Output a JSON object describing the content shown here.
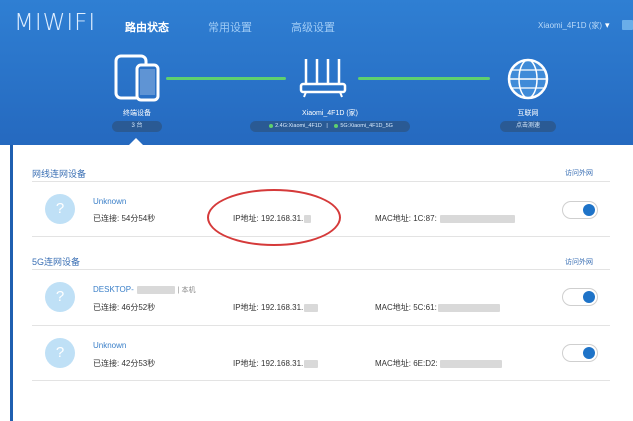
{
  "app": {
    "logo": "MIWIFI"
  },
  "nav": {
    "items": [
      {
        "label": "路由状态",
        "active": true
      },
      {
        "label": "常用设置",
        "active": false
      },
      {
        "label": "高级设置",
        "active": false
      }
    ],
    "user_menu": "Xiaomi_4F1D (家)",
    "chevron": "▾"
  },
  "topology": {
    "devices": {
      "label": "终端设备",
      "count": "3 台"
    },
    "router": {
      "name": "Xiaomi_4F1D (家)",
      "ssid_24": "2.4G:Xiaomi_4F1D",
      "ssid_5": "5G:Xiaomi_4F1D_5G",
      "separator": "|"
    },
    "internet": {
      "label": "互联网",
      "button": "点击测速"
    }
  },
  "sections": [
    {
      "title": "网线连网设备",
      "link": "访问外网",
      "devices": [
        {
          "name": "Unknown",
          "tag": "",
          "connected": "已连接: 54分54秒",
          "ip": "IP地址: 192.168.31.",
          "mac": "MAC地址: 1C:87:",
          "access_enabled": true
        }
      ]
    },
    {
      "title": "5G连网设备",
      "link": "访问外网",
      "devices": [
        {
          "name": "DESKTOP-",
          "tag": "| 本机",
          "connected": "已连接: 46分52秒",
          "ip": "IP地址: 192.168.31.",
          "mac": "MAC地址: 5C:61:",
          "access_enabled": true
        },
        {
          "name": "Unknown",
          "tag": "",
          "connected": "已连接: 42分53秒",
          "ip": "IP地址: 192.168.31.",
          "mac": "MAC地址: 6E:D2:",
          "access_enabled": true
        }
      ]
    }
  ],
  "avatar_glyph": "?",
  "colors": {
    "header_blue": "#2a71c6",
    "link_blue": "#3a6fb4",
    "connection_green": "#5fd06e",
    "toggle_blue": "#1e73c8",
    "highlight_red": "#d53a3a"
  }
}
